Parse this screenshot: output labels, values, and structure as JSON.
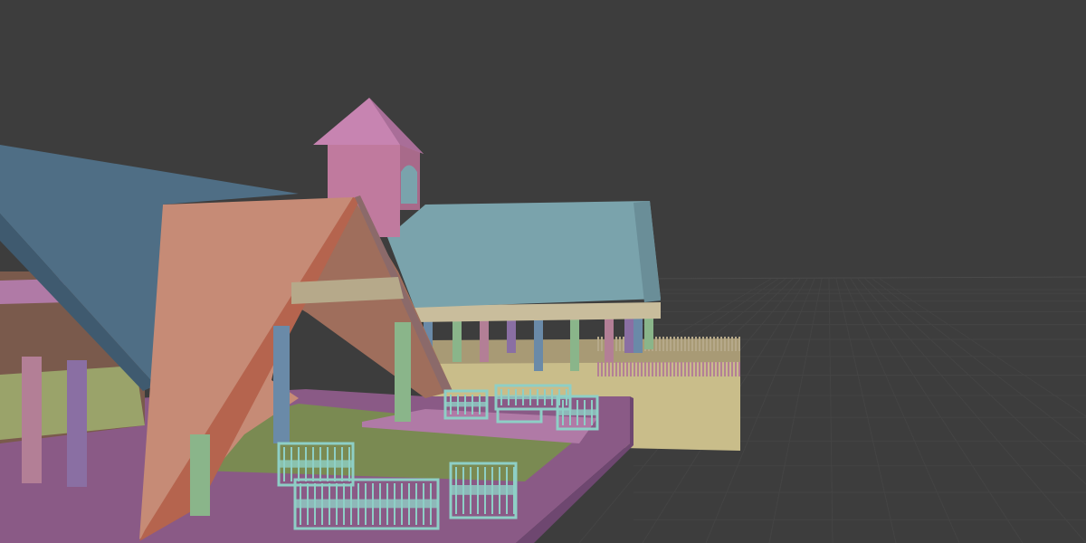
{
  "viewport": {
    "background_color": "#3d3d3d",
    "ground_grid_color": "#444444",
    "horizon_line_color": "#4a4a4a"
  },
  "palette": {
    "roof_blue": "#4f6e85",
    "roof_teal": "#7aa3ac",
    "roof_salmon": "#c68b76",
    "tower_pink": "#c07a9e",
    "tower_roof": "#c784b1",
    "floor_purple": "#8a5a86",
    "lawn_green": "#7a8a52",
    "wall_tan": "#c9bd8a",
    "column_green": "#8ab58a",
    "column_blue": "#6a8aa8",
    "column_pink": "#b37f96",
    "column_purple": "#8a6fa3",
    "furniture_cyan": "#8ecfc6",
    "railing_tan": "#b6a98a"
  },
  "objects": [
    "main-hall-roof",
    "a-frame-gable",
    "bell-tower",
    "side-pavilion",
    "colonnade",
    "lawn-courtyard",
    "garden-furniture-set"
  ]
}
